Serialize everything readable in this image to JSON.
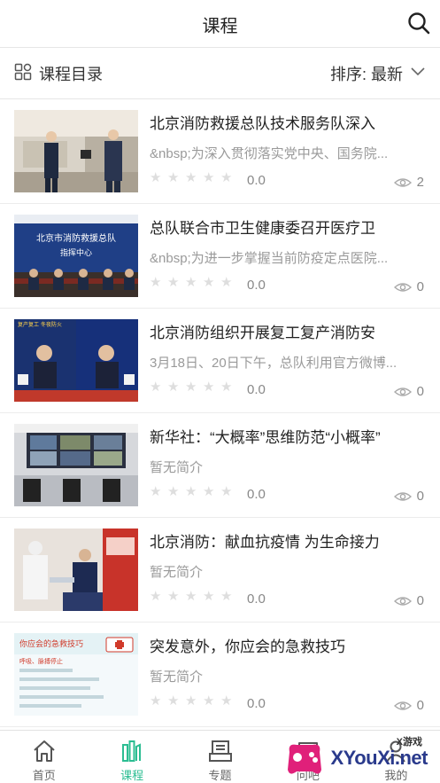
{
  "header": {
    "title": "课程",
    "search_icon": "search-icon"
  },
  "toolbar": {
    "catalog_label": "课程目录",
    "catalog_icon": "grid-icon",
    "sort_label": "排序: 最新",
    "sort_icon": "chevron-down-icon"
  },
  "courses": [
    {
      "title": "北京消防救援总队技术服务队深入",
      "desc": "&nbsp;为深入贯彻落实党中央、国务院...",
      "rating": "0.0",
      "views": "2",
      "thumb": "scene-officers-store"
    },
    {
      "title": "总队联合市卫生健康委召开医疗卫",
      "desc": "&nbsp;为进一步掌握当前防疫定点医院...",
      "rating": "0.0",
      "views": "0",
      "thumb": "scene-meeting-room"
    },
    {
      "title": "北京消防组织开展复工复产消防安",
      "desc": "3月18日、20日下午，总队利用官方微博...",
      "rating": "0.0",
      "views": "0",
      "thumb": "scene-live-stream"
    },
    {
      "title": "新华社：“大概率”思维防范“小概率”",
      "desc": "暂无简介",
      "rating": "0.0",
      "views": "0",
      "thumb": "scene-control-center"
    },
    {
      "title": "北京消防：献血抗疫情 为生命接力",
      "desc": "暂无简介",
      "rating": "0.0",
      "views": "0",
      "thumb": "scene-blood-donation"
    },
    {
      "title": "突发意外，你应会的急救技巧",
      "desc": "暂无简介",
      "rating": "0.0",
      "views": "0",
      "thumb": "scene-first-aid-poster"
    }
  ],
  "thumb_texts": {
    "meeting_banner_1": "北京市消防救援总队",
    "meeting_banner_2": "指挥中心",
    "stream_caption": "复产复工 冬夜防火",
    "poster_title": "你应会的急救技巧",
    "poster_sub": "呼吸、脉搏停止"
  },
  "tabs": [
    {
      "label": "首页",
      "icon": "home-icon"
    },
    {
      "label": "课程",
      "icon": "course-icon",
      "active": true
    },
    {
      "label": "专题",
      "icon": "topic-icon"
    },
    {
      "label": "问吧",
      "icon": "chat-icon"
    },
    {
      "label": "我的",
      "icon": "user-icon"
    }
  ],
  "watermark": {
    "small": "X游戏",
    "big": "XYouXi.net"
  },
  "colors": {
    "accent": "#2bbd92",
    "text": "#222222",
    "muted": "#9a9a9a"
  }
}
